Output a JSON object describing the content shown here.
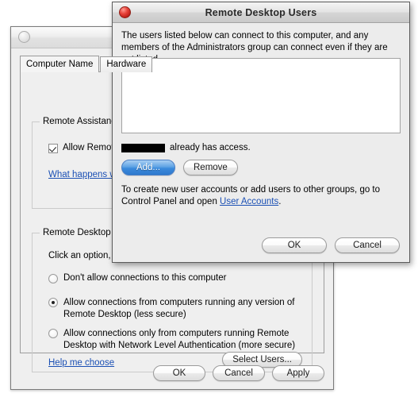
{
  "background_window": {
    "title": "",
    "tabs": [
      {
        "label": "Computer Name",
        "active": true
      },
      {
        "label": "Hardware",
        "active": false
      }
    ],
    "remote_assistance": {
      "group_label": "Remote Assistance",
      "checkbox_label": "Allow Remote Assistance connections to this computer",
      "checkbox_checked": true,
      "link_label": "What happens when I enable Remote Assistance?"
    },
    "remote_desktop": {
      "group_label": "Remote Desktop",
      "intro": "Click an option, and then specify who can connect, if needed.",
      "options": [
        {
          "label": "Don't allow connections to this computer",
          "selected": false
        },
        {
          "label": "Allow connections from computers running any version of Remote Desktop (less secure)",
          "selected": true
        },
        {
          "label": "Allow connections only from computers running Remote Desktop with Network Level Authentication (more secure)",
          "selected": false
        }
      ],
      "help_link": "Help me choose",
      "select_users_button": "Select Users..."
    },
    "footer_buttons": [
      {
        "label": "OK",
        "default": false
      },
      {
        "label": "Cancel",
        "default": false
      },
      {
        "label": "Apply",
        "default": false
      }
    ]
  },
  "dialog": {
    "title": "Remote Desktop Users",
    "close_icon": "close-button-red",
    "description": "The users listed below can connect to this computer, and any members of the Administrators group can connect even if they are not listed.",
    "user_list": [],
    "access_note": {
      "redacted_user": "",
      "text": "already has access."
    },
    "list_buttons": [
      {
        "label": "Add...",
        "default": true
      },
      {
        "label": "Remove",
        "default": false
      }
    ],
    "create_accounts_text_before": "To create new user accounts or add users to other groups, go to Control Panel and open ",
    "create_accounts_link": "User Accounts",
    "create_accounts_text_after": ".",
    "footer_buttons": [
      {
        "label": "OK",
        "default": false
      },
      {
        "label": "Cancel",
        "default": false
      }
    ]
  },
  "colors": {
    "window_bg": "#efefef",
    "dialog_bg": "#ececec",
    "link": "#1a4fb4",
    "default_button": "#3b8adc",
    "close_button": "#c22a20"
  }
}
